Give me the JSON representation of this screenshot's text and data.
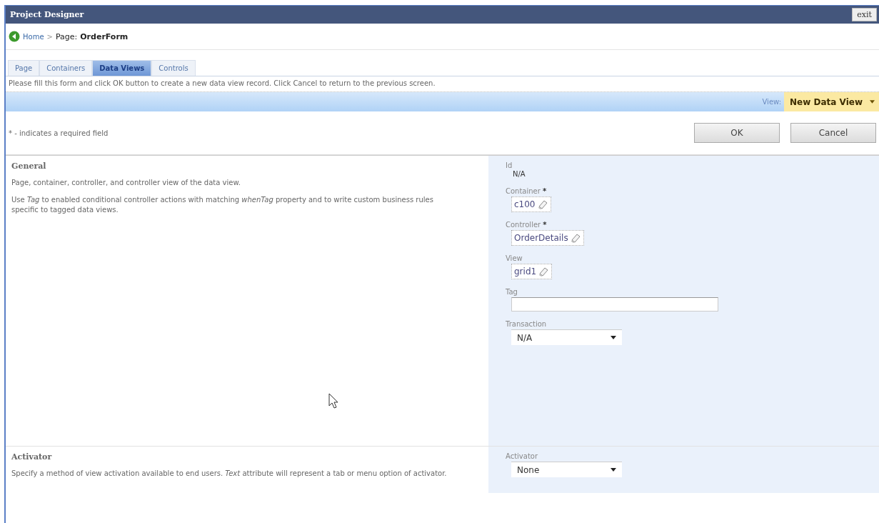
{
  "window": {
    "title": "Project Designer",
    "exit_button": "exit"
  },
  "breadcrumb": {
    "home": "Home",
    "separator": ">",
    "page_label": "Page:",
    "page_name": "OrderForm"
  },
  "tabs": [
    {
      "label": "Page",
      "selected": false
    },
    {
      "label": "Containers",
      "selected": false
    },
    {
      "label": "Data Views",
      "selected": true
    },
    {
      "label": "Controls",
      "selected": false
    }
  ],
  "instruction": "Please fill this form and click OK button to create a new data view record. Click Cancel to return to the previous screen.",
  "view_bar": {
    "label": "View:",
    "value": "New Data View"
  },
  "required_note": "* - indicates a required field",
  "buttons": [
    "OK",
    "Cancel"
  ],
  "sections": [
    {
      "title": "General",
      "paragraphs": [
        "Page, container, controller, and controller view of the data view.",
        "Use *Tag* to enabled conditional controller actions with matching *whenTag* property and to write custom business rules specific to tagged data views."
      ],
      "fields": [
        {
          "kind": "static",
          "label": "Id",
          "value": "N/A"
        },
        {
          "kind": "lookup",
          "label": "Container",
          "required_mark": "*",
          "value": "c100"
        },
        {
          "kind": "lookup",
          "label": "Controller",
          "required_mark": "*",
          "value": "OrderDetails"
        },
        {
          "kind": "lookup",
          "label": "View",
          "value": "grid1"
        },
        {
          "kind": "text",
          "label": "Tag"
        },
        {
          "kind": "dropdown",
          "label": "Transaction",
          "value": "N/A"
        }
      ]
    },
    {
      "title": "Activator",
      "paragraphs": [
        "Specify a method of view activation available to end users. *Text* attribute will represent a tab or menu option of activator."
      ],
      "fields": [
        {
          "kind": "dropdown",
          "label": "Activator",
          "value": "None"
        }
      ]
    }
  ]
}
